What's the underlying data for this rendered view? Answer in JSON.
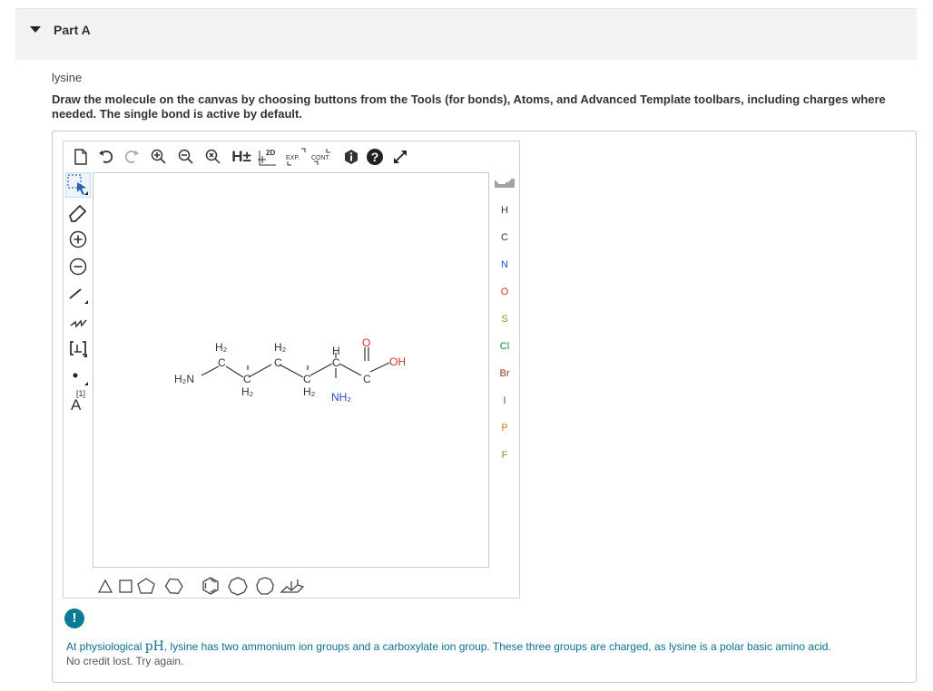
{
  "part": {
    "title": "Part A"
  },
  "compound_name": "lysine",
  "instructions": "Draw the molecule on the canvas by choosing buttons from the Tools (for bonds), Atoms, and Advanced Template toolbars, including charges where needed. The single bond is active by default.",
  "top_toolbar": {
    "hplus_label": "H±",
    "twod_label": "2D",
    "exp_label": "EXP.",
    "cont_label": "CONT."
  },
  "left_toolbar": {
    "atom_map_label": "[1]",
    "atom_map_letter": "A"
  },
  "atoms": [
    "H",
    "C",
    "N",
    "O",
    "S",
    "Cl",
    "Br",
    "I",
    "P",
    "F"
  ],
  "atom_colors": {
    "H": "#333333",
    "C": "#333333",
    "N": "#2a49c4",
    "O": "#d92b2b",
    "S": "#a8891a",
    "Cl": "#1f8a2f",
    "Br": "#8a3a1a",
    "I": "#7b2aa6",
    "P": "#c97c12",
    "F": "#6aa41a"
  },
  "molecule": {
    "h2n": "H₂N",
    "ch2_1": "C",
    "h2_1": "H₂",
    "ch2_2": "C",
    "h2_2": "H₂",
    "ch2_3": "C",
    "h2_3": "H₂",
    "ch2_4": "C",
    "h2_4": "H₂",
    "ca": "C",
    "h_ca": "H",
    "nh2": "NH₂",
    "cooh_c": "C",
    "o": "O",
    "oh": "OH"
  },
  "feedback": {
    "icon": "!",
    "text_before": "At physiological ",
    "ph": "pH",
    "text_after": ", lysine has two ammonium ion groups and a carboxylate ion group. These three groups are charged, as lysine is a polar basic amino acid.",
    "sub": "No credit lost. Try again."
  }
}
